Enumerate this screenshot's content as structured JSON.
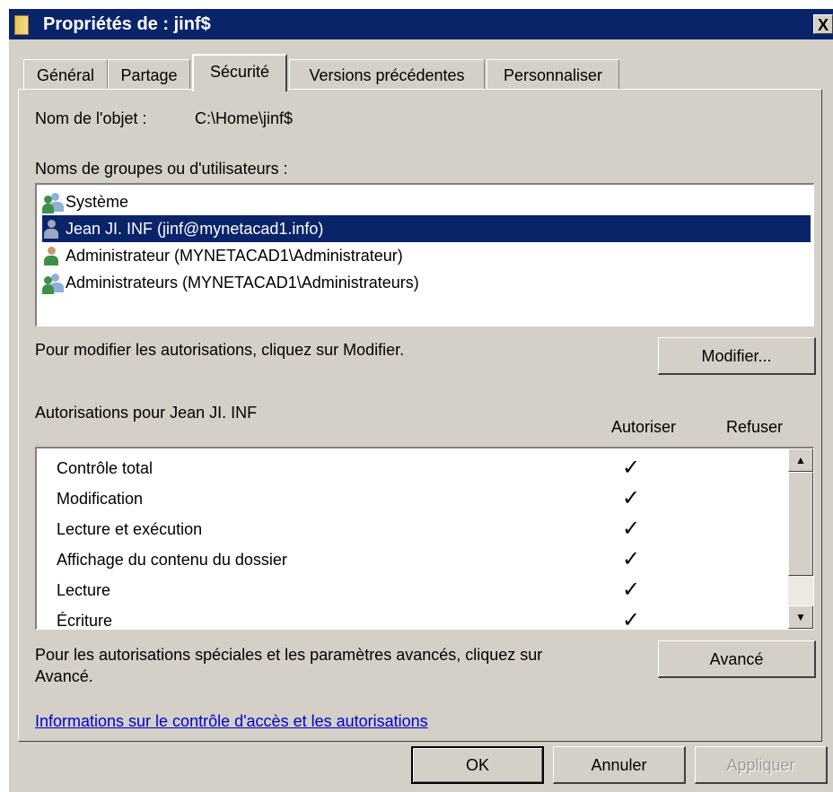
{
  "window": {
    "title": "Propriétés de : jinf$",
    "close_glyph": "X"
  },
  "tabs": [
    {
      "label": "Général",
      "active": false
    },
    {
      "label": "Partage",
      "active": false
    },
    {
      "label": "Sécurité",
      "active": true
    },
    {
      "label": "Versions précédentes",
      "active": false
    },
    {
      "label": "Personnaliser",
      "active": false
    }
  ],
  "object": {
    "label": "Nom de l'objet :",
    "value": "C:\\Home\\jinf$"
  },
  "groups": {
    "label": "Noms de groupes ou d'utilisateurs :",
    "items": [
      {
        "label": "Système",
        "icon": "group-icon",
        "selected": false
      },
      {
        "label": "Jean JI. INF (jinf@mynetacad1.info)",
        "icon": "user-icon",
        "selected": true
      },
      {
        "label": "Administrateur (MYNETACAD1\\Administrateur)",
        "icon": "user-icon",
        "selected": false
      },
      {
        "label": "Administrateurs (MYNETACAD1\\Administrateurs)",
        "icon": "group-icon",
        "selected": false
      }
    ]
  },
  "modify": {
    "hint": "Pour modifier les autorisations, cliquez sur Modifier.",
    "button": "Modifier..."
  },
  "permissions": {
    "title": "Autorisations pour Jean JI. INF",
    "allow_header": "Autoriser",
    "deny_header": "Refuser",
    "rows": [
      {
        "label": "Contrôle total",
        "allow": true,
        "deny": false
      },
      {
        "label": "Modification",
        "allow": true,
        "deny": false
      },
      {
        "label": "Lecture et exécution",
        "allow": true,
        "deny": false
      },
      {
        "label": "Affichage du contenu du dossier",
        "allow": true,
        "deny": false
      },
      {
        "label": "Lecture",
        "allow": true,
        "deny": false
      },
      {
        "label": "Écriture",
        "allow": true,
        "deny": false
      }
    ],
    "check_glyph": "✓"
  },
  "advanced": {
    "hint_line1": "Pour les autorisations spéciales et les paramètres avancés, cliquez sur",
    "hint_line2": "Avancé.",
    "button": "Avancé"
  },
  "help_link": "Informations sur le contrôle d'accès et les autorisations",
  "footer": {
    "ok": "OK",
    "cancel": "Annuler",
    "apply": "Appliquer"
  },
  "colors": {
    "title_bar": "#0a246a",
    "dialog_bg": "#d4d0c8",
    "selection": "#0a246a",
    "link": "#0000cc",
    "user_icon_dark": "#2a3550",
    "user_icon_green": "#3f8f4a",
    "group_icon_light": "#8fb0d6"
  }
}
